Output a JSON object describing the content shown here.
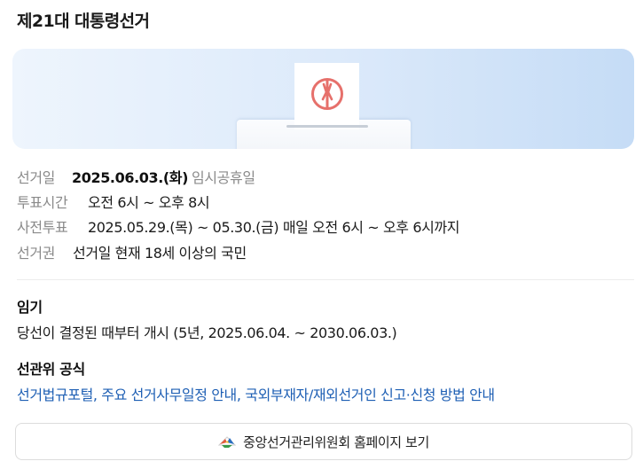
{
  "header": {
    "title": "제21대 대통령선거"
  },
  "banner": {
    "icon": "ballot-box-illustration",
    "colors": {
      "stamp": "#e6706b",
      "gradient_start": "#eef5fd",
      "gradient_end": "#c5dcf6"
    }
  },
  "info": {
    "election_day": {
      "label": "선거일",
      "value": "2025.06.03.(화)",
      "note": "임시공휴일"
    },
    "voting_hours": {
      "label": "투표시간",
      "value": "오전 6시 ~ 오후 8시"
    },
    "early_voting": {
      "label": "사전투표",
      "value": "2025.05.29.(목) ~ 05.30.(금) 매일 오전 6시 ~ 오후 6시까지"
    },
    "voting_right": {
      "label": "선거권",
      "value": "선거일 현재 18세 이상의 국민"
    }
  },
  "term": {
    "title": "임기",
    "text": "당선이 결정된 때부터 개시 (5년, 2025.06.04. ~ 2030.06.03.)"
  },
  "official": {
    "title": "선관위 공식",
    "links": [
      "선거법규포털",
      "주요 선거사무일정 안내",
      "국외부재자/재외선거인 신고·신청 방법 안내"
    ],
    "separator": ", "
  },
  "homepage_button": {
    "label": "중앙선거관리위원회 홈페이지 보기",
    "icon": "nec-logo-icon"
  }
}
